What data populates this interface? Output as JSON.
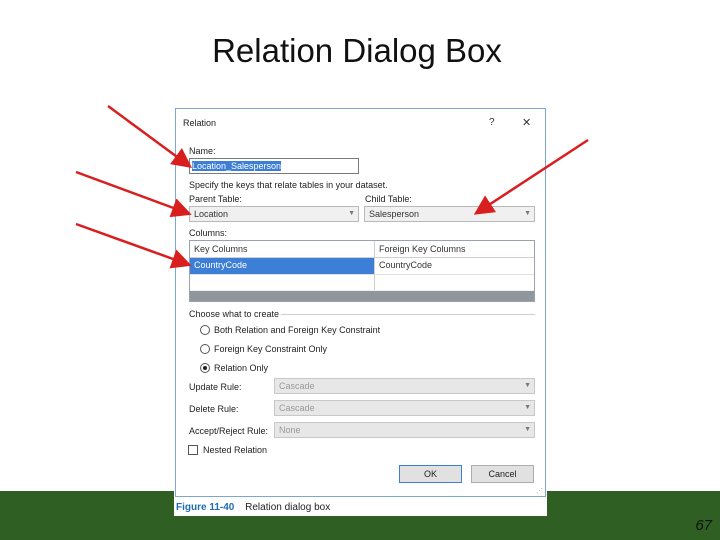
{
  "slide": {
    "title": "Relation Dialog Box",
    "page_number": "67"
  },
  "dialog": {
    "title": "Relation",
    "help_icon": "?",
    "close_icon": "✕",
    "name_label": "Name:",
    "name_value": "Location_Salesperson",
    "instruction": "Specify the keys that relate tables in your dataset.",
    "parent_table_label": "Parent Table:",
    "parent_table_value": "Location",
    "child_table_label": "Child Table:",
    "child_table_value": "Salesperson",
    "columns_label": "Columns:",
    "grid": {
      "headers": [
        "Key Columns",
        "Foreign Key Columns"
      ],
      "rows": [
        [
          "CountryCode",
          "CountryCode"
        ]
      ]
    },
    "choose_label": "Choose what to create",
    "options": [
      {
        "label": "Both Relation and Foreign Key Constraint",
        "selected": false
      },
      {
        "label": "Foreign Key Constraint Only",
        "selected": false
      },
      {
        "label": "Relation Only",
        "selected": true
      }
    ],
    "update_rule_label": "Update Rule:",
    "update_rule_value": "Cascade",
    "delete_rule_label": "Delete Rule:",
    "delete_rule_value": "Cascade",
    "accept_reject_label": "Accept/Reject Rule:",
    "accept_reject_value": "None",
    "nested_relation_label": "Nested Relation",
    "nested_relation_checked": false,
    "ok_label": "OK",
    "cancel_label": "Cancel"
  },
  "caption": {
    "figure_number": "Figure 11-40",
    "text": "Relation dialog box"
  },
  "colors": {
    "arrow": "#d91e1e",
    "selection": "#3d7fd6",
    "band": "#2f5f22"
  }
}
